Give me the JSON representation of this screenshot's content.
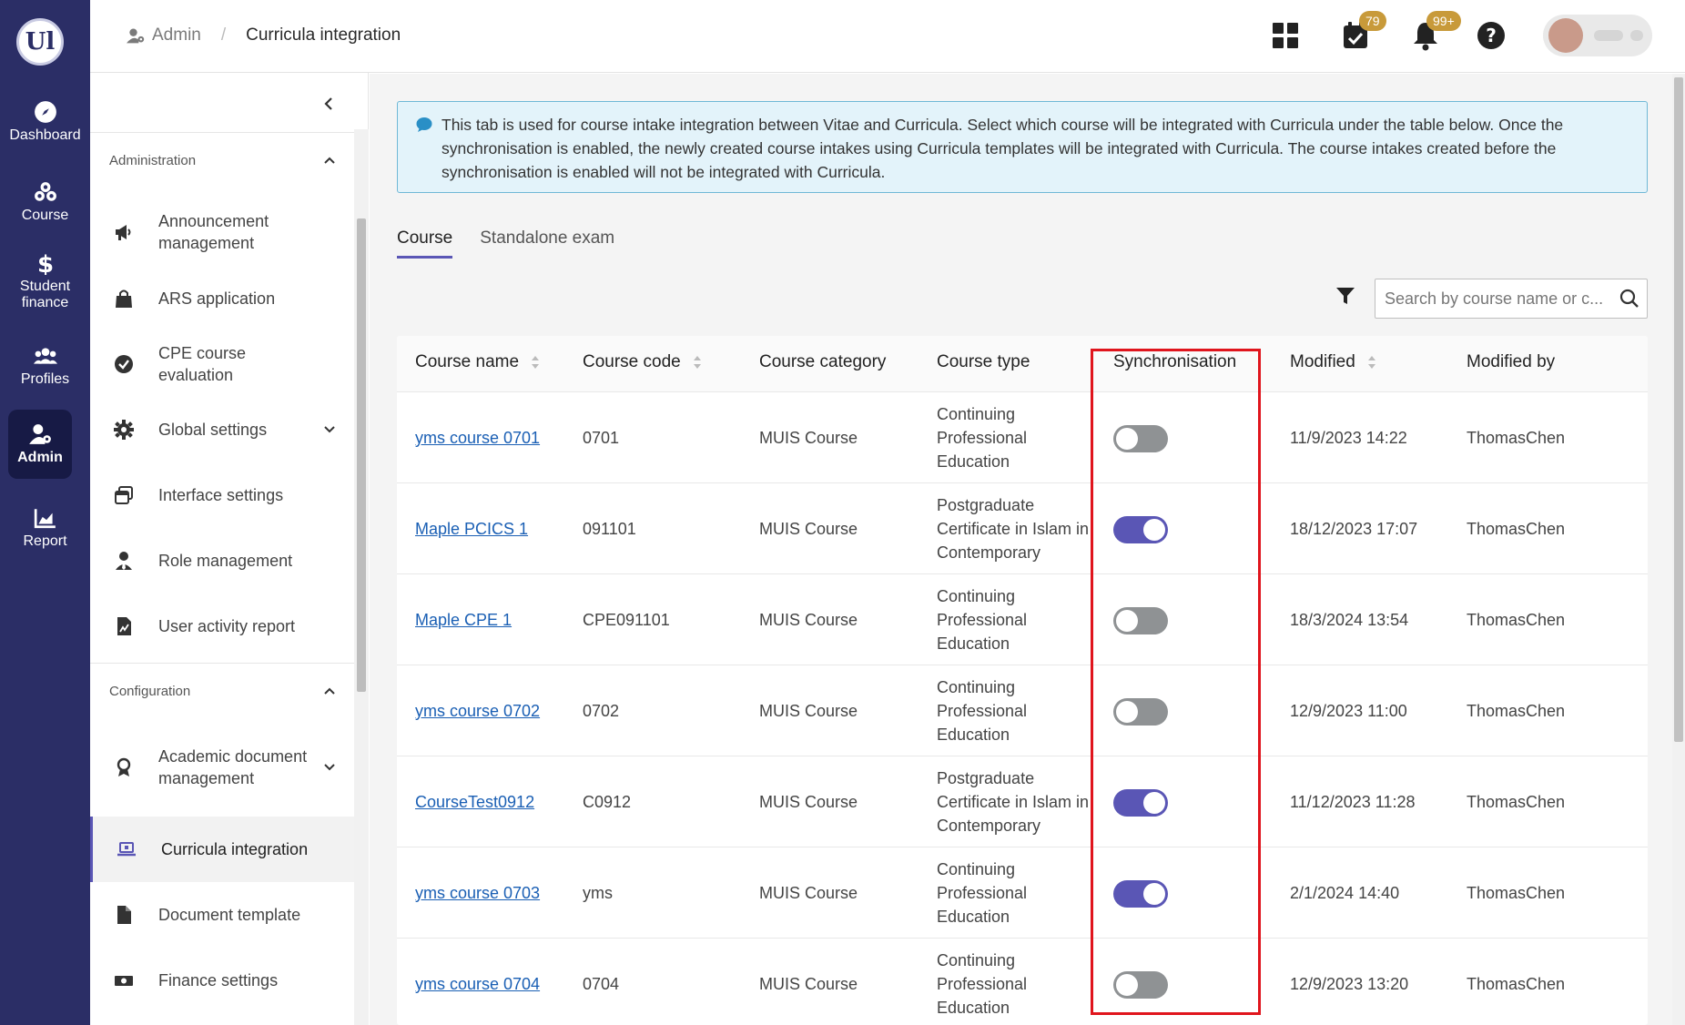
{
  "rail": {
    "logo_text": "Ul",
    "items": [
      {
        "label": "Dashboard",
        "icon": "compass-icon"
      },
      {
        "label": "Course",
        "icon": "course-icon"
      },
      {
        "label": "Student\nfinance",
        "label1": "Student",
        "label2": "finance",
        "icon": "dollar-icon"
      },
      {
        "label": "Profiles",
        "icon": "users-icon"
      },
      {
        "label": "Admin",
        "icon": "admin-icon"
      },
      {
        "label": "Report",
        "icon": "chart-icon"
      }
    ]
  },
  "header": {
    "breadcrumb_root": "Admin",
    "breadcrumb_sep": "/",
    "breadcrumb_current": "Curricula integration",
    "tasks_badge": "79",
    "notifications_badge": "99+"
  },
  "sidebar": {
    "administration_title": "Administration",
    "administration_items": [
      {
        "label": "Announcement management",
        "icon": "megaphone-icon"
      },
      {
        "label": "ARS application",
        "icon": "bag-icon"
      },
      {
        "label": "CPE course evaluation",
        "icon": "check-circle-icon"
      },
      {
        "label": "Global settings",
        "icon": "gear-icon"
      },
      {
        "label": "Interface settings",
        "icon": "window-icon"
      },
      {
        "label": "Role management",
        "icon": "user-tie-icon"
      },
      {
        "label": "User activity report",
        "icon": "report-file-icon"
      }
    ],
    "configuration_title": "Configuration",
    "configuration_items": [
      {
        "label": "Academic document management",
        "icon": "award-icon"
      },
      {
        "label": "Curricula integration",
        "icon": "laptop-icon"
      },
      {
        "label": "Document template",
        "icon": "file-icon"
      },
      {
        "label": "Finance settings",
        "icon": "money-icon"
      }
    ]
  },
  "main": {
    "info_text": "This tab is used for course intake integration between Vitae and Curricula. Select which course will be integrated with Curricula under the table below. Once the synchronisation is enabled, the newly created course intakes using Curricula templates will be integrated with Curricula. The course intakes created before the synchronisation is enabled will not be integrated with Curricula.",
    "tabs": [
      {
        "label": "Course",
        "active": true
      },
      {
        "label": "Standalone exam",
        "active": false
      }
    ],
    "search_placeholder": "Search by course name or c...",
    "columns": {
      "name": "Course name",
      "code": "Course code",
      "category": "Course category",
      "type": "Course type",
      "sync": "Synchronisation",
      "modified": "Modified",
      "modified_by": "Modified by"
    },
    "rows": [
      {
        "name": "yms course 0701",
        "code": "0701",
        "category": "MUIS Course",
        "type": "Continuing Professional Education",
        "sync": false,
        "modified": "11/9/2023 14:22",
        "modified_by": "ThomasChen"
      },
      {
        "name": "Maple PCICS 1",
        "code": "091101",
        "category": "MUIS Course",
        "type": "Postgraduate Certificate in Islam in Contemporary",
        "sync": true,
        "modified": "18/12/2023 17:07",
        "modified_by": "ThomasChen"
      },
      {
        "name": "Maple CPE 1",
        "code": "CPE091101",
        "category": "MUIS Course",
        "type": "Continuing Professional Education",
        "sync": false,
        "modified": "18/3/2024 13:54",
        "modified_by": "ThomasChen"
      },
      {
        "name": "yms course 0702",
        "code": "0702",
        "category": "MUIS Course",
        "type": "Continuing Professional Education",
        "sync": false,
        "modified": "12/9/2023 11:00",
        "modified_by": "ThomasChen"
      },
      {
        "name": "CourseTest0912",
        "code": "C0912",
        "category": "MUIS Course",
        "type": "Postgraduate Certificate in Islam in Contemporary",
        "sync": true,
        "modified": "11/12/2023 11:28",
        "modified_by": "ThomasChen"
      },
      {
        "name": "yms course 0703",
        "code": "yms",
        "category": "MUIS Course",
        "type": "Continuing Professional Education",
        "sync": true,
        "modified": "2/1/2024 14:40",
        "modified_by": "ThomasChen"
      },
      {
        "name": "yms course 0704",
        "code": "0704",
        "category": "MUIS Course",
        "type": "Continuing Professional Education",
        "sync": false,
        "modified": "12/9/2023 13:20",
        "modified_by": "ThomasChen"
      }
    ]
  },
  "colors": {
    "rail_bg": "#2b2e66",
    "accent": "#5a56b5",
    "link": "#1a5fb4",
    "highlight": "#e0151d",
    "badge": "#c89a3a",
    "info_bg": "#e3f3fa"
  }
}
